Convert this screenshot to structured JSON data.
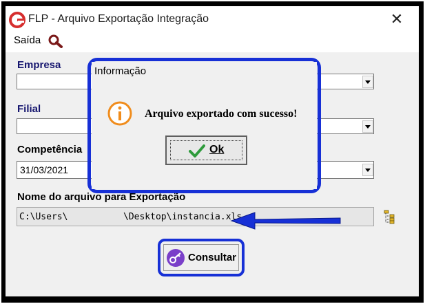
{
  "window": {
    "title": "FLP - Arquivo Exportação Integração",
    "close_glyph": "✕",
    "logo_icon": "app-logo-icon"
  },
  "menu": {
    "saida_label": "Saída",
    "search_icon": "search-icon"
  },
  "form": {
    "empresa": {
      "label": "Empresa",
      "value": ""
    },
    "filial": {
      "label": "Filial",
      "value": ""
    },
    "competencia": {
      "label": "Competência",
      "value": "31/03/2021"
    },
    "export_path": {
      "label": "Nome do arquivo para Exportação",
      "value_start": "C:\\Users\\",
      "value_end": "\\Desktop\\instancia.xls"
    },
    "browse_icon": "folder-tree-icon"
  },
  "consultar": {
    "label": "Consultar",
    "icon": "key-icon"
  },
  "dialog": {
    "title": "Informação",
    "message": "Arquivo exportado com sucesso!",
    "icon": "info-icon",
    "ok_label": "Ok",
    "ok_icon": "checkmark-icon"
  },
  "colors": {
    "highlight_blue": "#1730d6",
    "label_navy": "#16166f",
    "info_orange": "#f08c1c",
    "check_green": "#2e9b3c",
    "logo_red": "#d62e2e"
  }
}
